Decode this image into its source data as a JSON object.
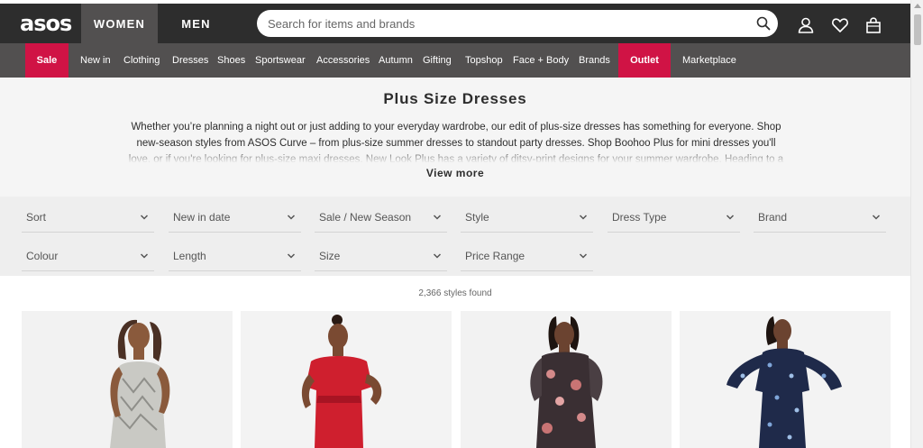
{
  "header": {
    "logo": "asos",
    "tabs": [
      {
        "label": "WOMEN",
        "active": true
      },
      {
        "label": "MEN",
        "active": false
      }
    ],
    "search_placeholder": "Search for items and brands",
    "icons": [
      "search-icon",
      "account-icon",
      "heart-icon",
      "bag-icon"
    ]
  },
  "nav": {
    "items": [
      "Sale",
      "New in",
      "Clothing",
      "Dresses",
      "Shoes",
      "Sportswear",
      "Accessories",
      "Autumn",
      "Gifting",
      "Topshop",
      "Face + Body",
      "Brands",
      "Outlet",
      "Marketplace"
    ],
    "highlight_color": "#d01345"
  },
  "page": {
    "title": "Plus Size Dresses",
    "description": "Whether you’re planning a night out or just adding to your everyday wardrobe, our edit of plus-size dresses has something for everyone. Shop new-season styles from ASOS Curve – from plus-size summer dresses to standout party dresses. Shop Boohoo Plus for mini dresses you'll love, or if you're looking for plus-size maxi dresses, New Look Plus has a variety of ditsy-print designs for your summer wardrobe. Heading to a wedding this summer?",
    "view_more": "View more"
  },
  "filters": [
    "Sort",
    "New in date",
    "Sale / New Season",
    "Style",
    "Dress Type",
    "Brand",
    "Colour",
    "Length",
    "Size",
    "Price Range"
  ],
  "results": {
    "count_text": "2,366 styles found"
  },
  "products": [
    {
      "name": "sequin-dress",
      "dress_color": "#c9c9c4"
    },
    {
      "name": "red-velvet-dress",
      "dress_color": "#cf1f2e"
    },
    {
      "name": "floral-maxi-dress",
      "dress_color": "#3a2f33"
    },
    {
      "name": "navy-print-dress",
      "dress_color": "#1f2a4a"
    }
  ]
}
